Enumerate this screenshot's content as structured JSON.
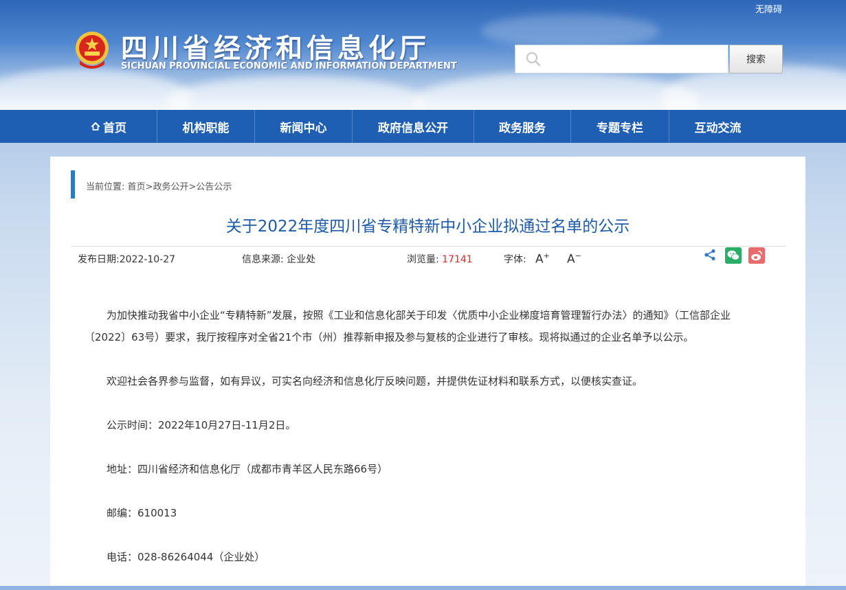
{
  "header": {
    "accessibility": "无障碍",
    "title": "四川省经济和信息化厅",
    "subtitle": "SICHUAN PROVINCIAL ECONOMIC AND INFORMATION DEPARTMENT",
    "search": {
      "placeholder": "",
      "button": "搜索"
    }
  },
  "nav": [
    {
      "label": "首页",
      "icon": "home-icon"
    },
    {
      "label": "机构职能"
    },
    {
      "label": "新闻中心"
    },
    {
      "label": "政府信息公开"
    },
    {
      "label": "政务服务"
    },
    {
      "label": "专题专栏"
    },
    {
      "label": "互动交流"
    }
  ],
  "breadcrumb": {
    "prefix": "当前位置:",
    "items": [
      "首页",
      "政务公开",
      "公告公示"
    ],
    "separator": ">"
  },
  "article": {
    "title": "关于2022年度四川省专精特新中小企业拟通过名单的公示",
    "meta": {
      "date_label": "发布日期:",
      "date": "2022-10-27",
      "source_label": "信息来源:",
      "source": "企业处",
      "views_label": "浏览量:",
      "views": "17141",
      "font_label": "字体:",
      "font_larger": "A",
      "font_smaller": "A"
    },
    "paragraphs": [
      "为加快推动我省中小企业“专精特新”发展，按照《工业和信息化部关于印发〈优质中小企业梯度培育管理暂行办法〉的通知》（工信部企业〔2022〕63号）要求，我厅按程序对全省21个市（州）推荐新申报及参与复核的企业进行了审核。现将拟通过的企业名单予以公示。",
      "欢迎社会各界参与监督，如有异议，可实名向经济和信息化厅反映问题，并提供佐证材料和联系方式，以便核实查证。",
      "公示时间：2022年10月27日-11月2日。",
      "地址：四川省经济和信息化厅（成都市青羊区人民东路66号）",
      "邮编：610013",
      "电话：028-86264044（企业处）"
    ]
  },
  "colors": {
    "nav_bg": "#1e5fb3",
    "title_blue": "#1f5aa6",
    "crumb_bar": "#2f78c7",
    "views_red": "#e02525",
    "wechat_green": "#2aae67",
    "weibo_red": "#e86b6b"
  },
  "icons": [
    "emblem-icon",
    "search-icon",
    "home-icon",
    "share-icon",
    "wechat-icon",
    "weibo-icon"
  ]
}
